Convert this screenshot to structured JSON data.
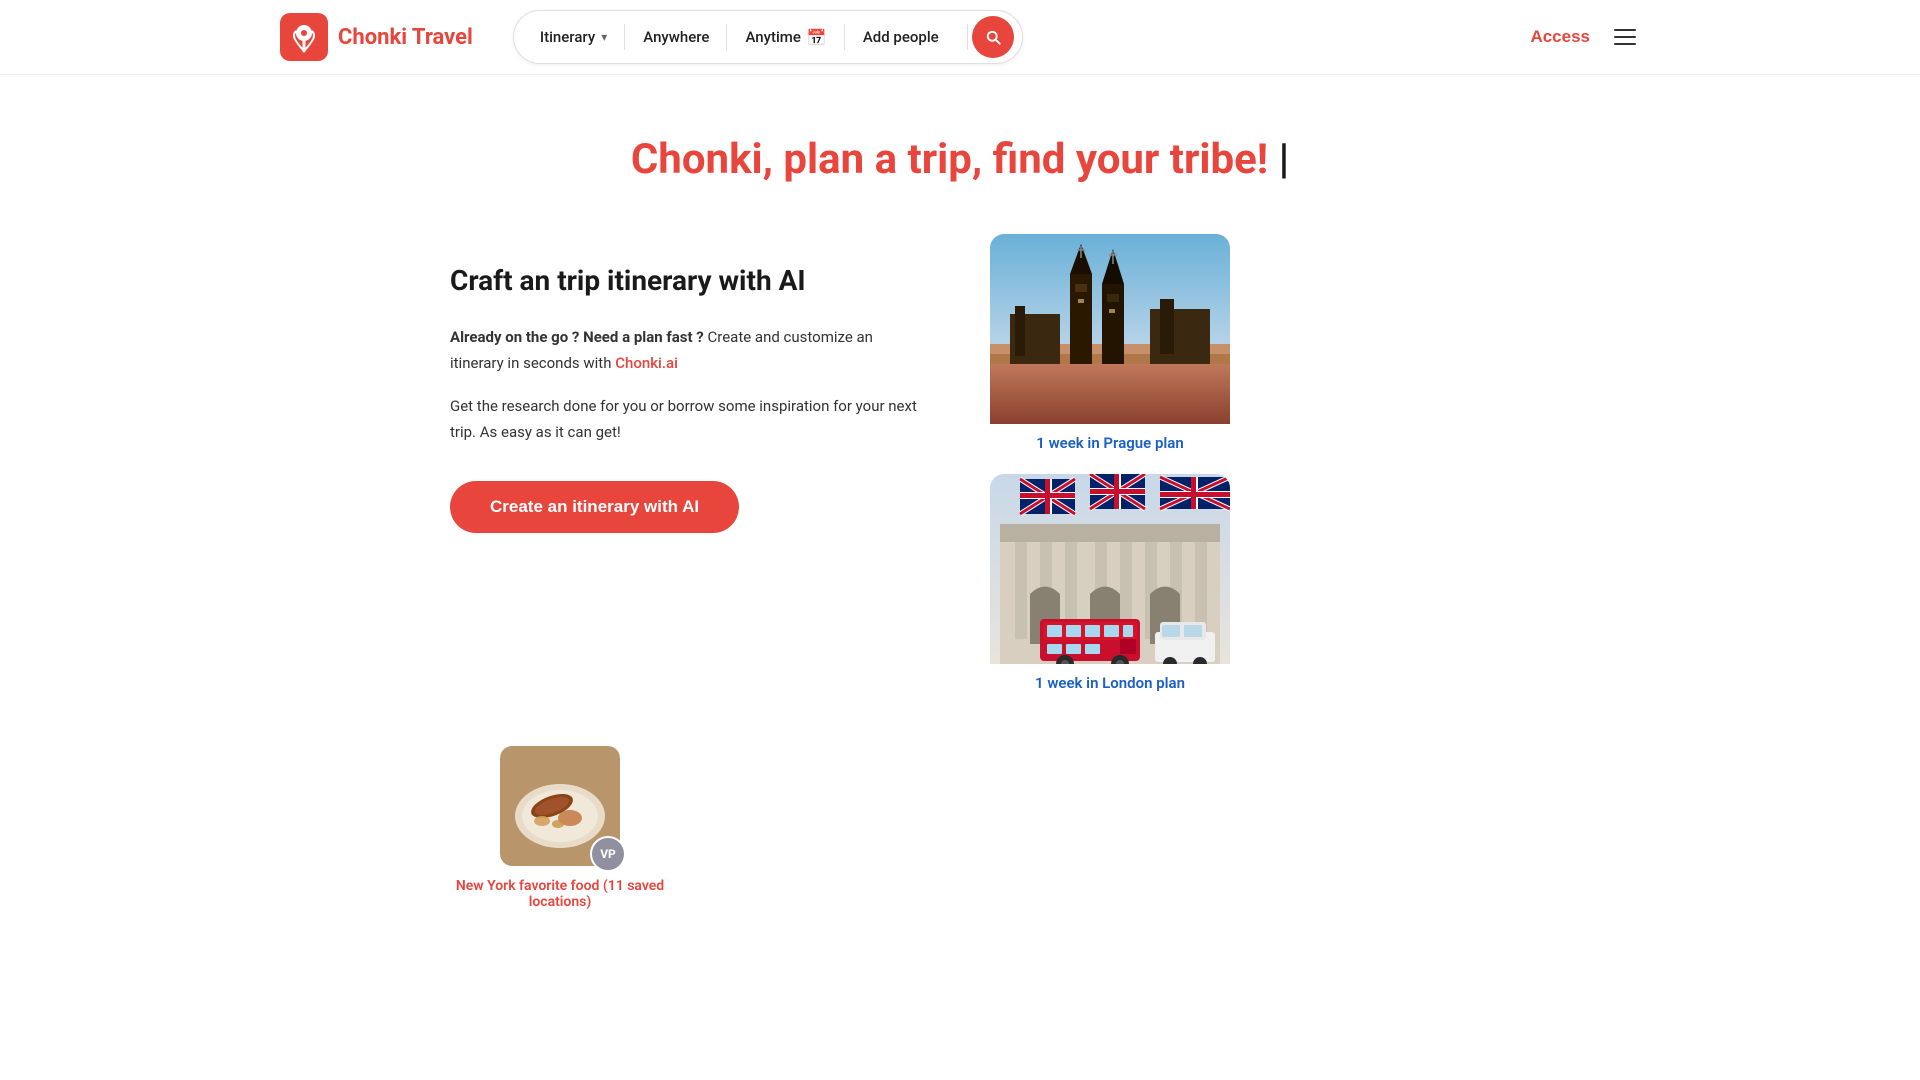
{
  "app": {
    "name": "Chonki Travel"
  },
  "header": {
    "logo_text": "Chonki Travel",
    "search": {
      "itinerary_label": "Itinerary",
      "itinerary_dropdown": "▾",
      "anywhere_label": "Anywhere",
      "anytime_label": "Anytime",
      "add_people_label": "Add people"
    },
    "access_label": "Access",
    "menu_icon": "menu-icon"
  },
  "hero": {
    "title_static": "Chonki,",
    "title_colored": "plan a trip, find your tribe!"
  },
  "craft_section": {
    "title": "Craft an trip itinerary with AI",
    "desc1_pre": "Already on the go ? Need a plan fast ?",
    "desc1_mid": "Create and customize an itinerary in seconds with",
    "desc1_link": "Chonki.ai",
    "desc2": "Get the research done for you or borrow some inspiration for your next trip. As easy as it can get!",
    "cta_label": "Create an itinerary with AI"
  },
  "trips": [
    {
      "label": "1 week in Prague plan",
      "type": "prague"
    },
    {
      "label": "1 week in London plan",
      "type": "london"
    }
  ],
  "food_card": {
    "title": "New York favorite food (11 saved locations)",
    "author_badge": "VP"
  }
}
